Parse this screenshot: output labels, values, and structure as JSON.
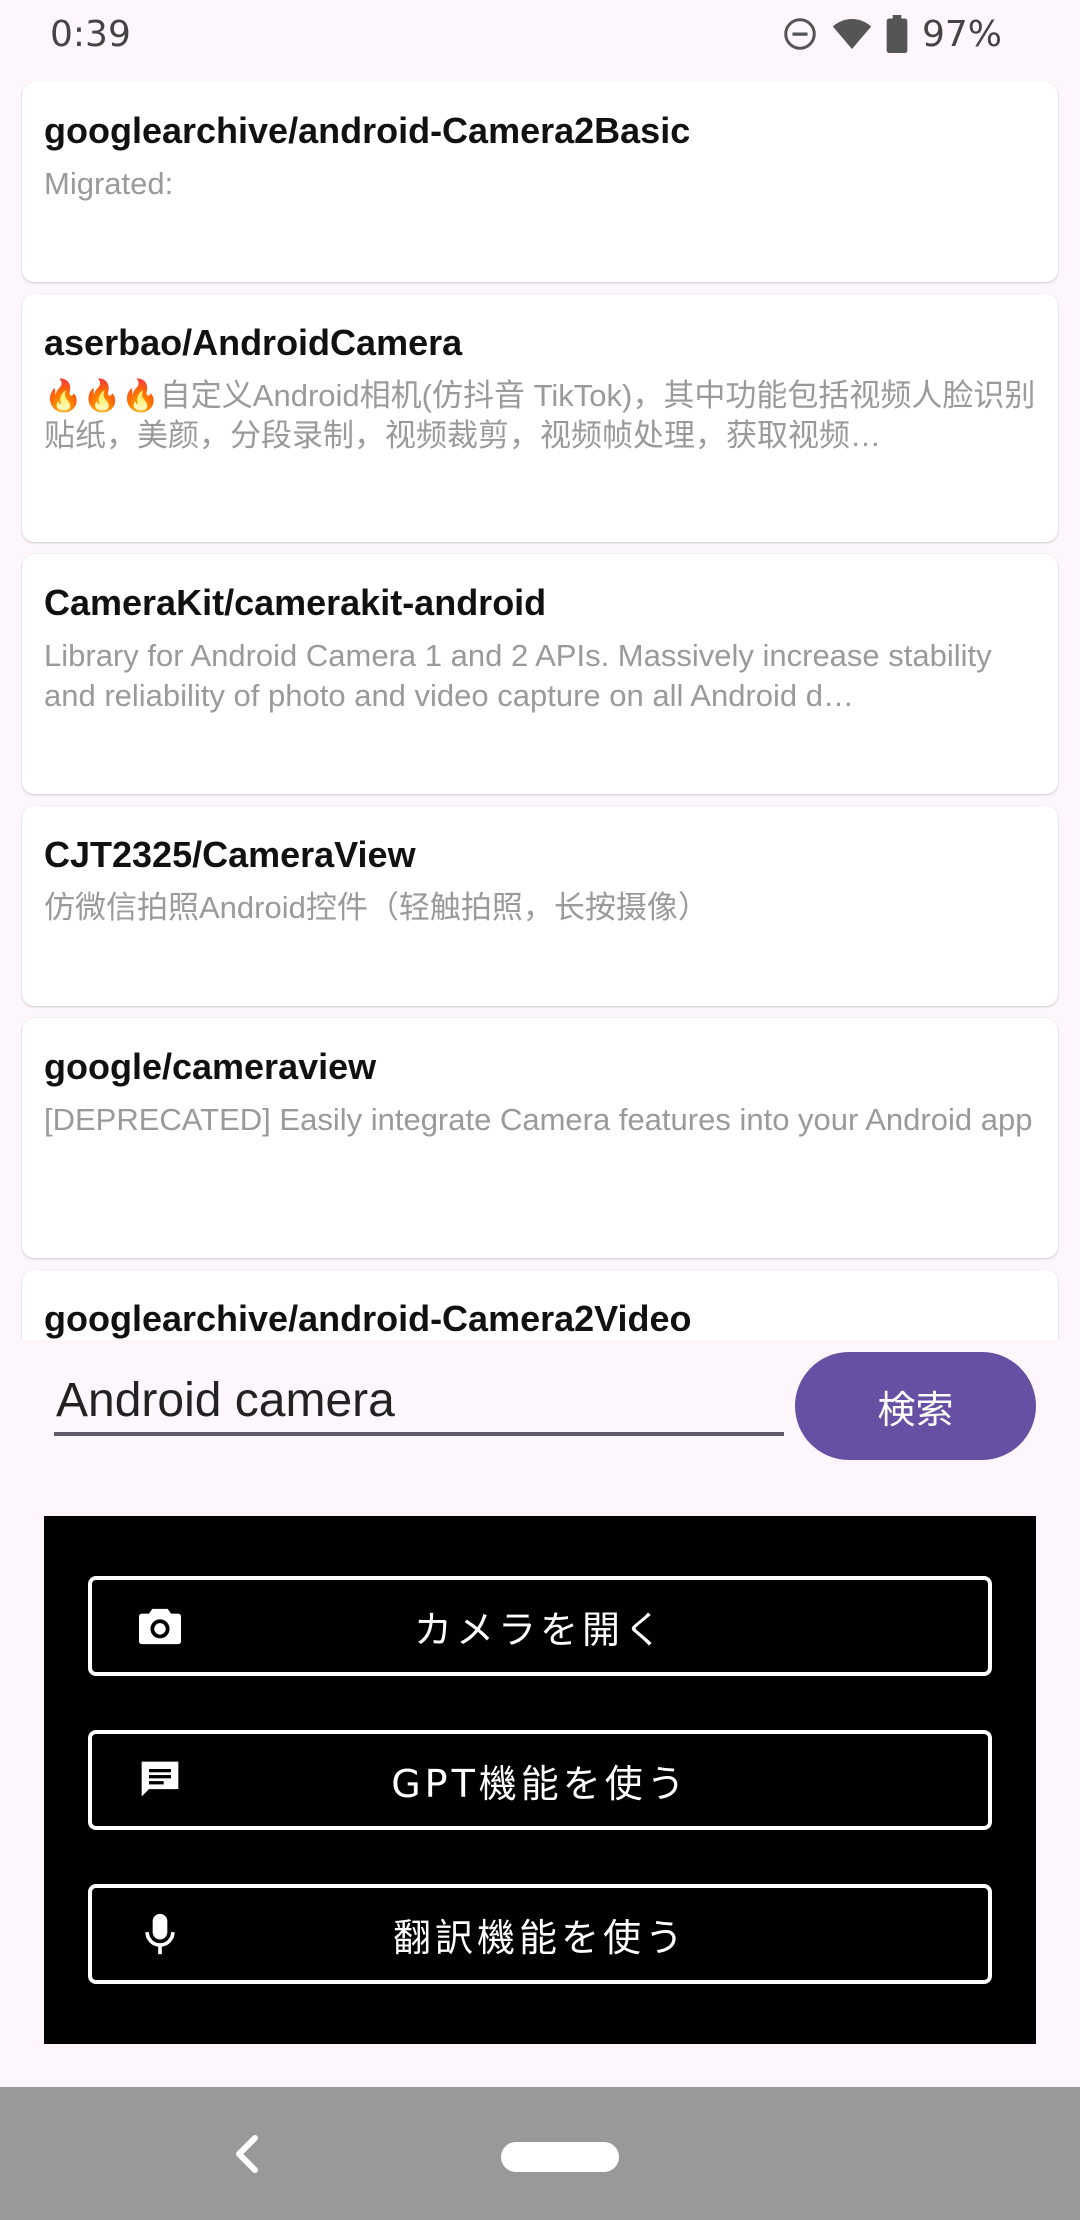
{
  "status_bar": {
    "time": "0:39",
    "battery": "97%",
    "icons": [
      "do-not-disturb-icon",
      "wifi-icon",
      "battery-icon"
    ]
  },
  "repos": [
    {
      "title": "googlearchive/android-Camera2Basic",
      "description": "Migrated:"
    },
    {
      "title": "aserbao/AndroidCamera",
      "description": "🔥🔥🔥自定义Android相机(仿抖音 TikTok)，其中功能包括视频人脸识别贴纸，美颜，分段录制，视频裁剪，视频帧处理，获取视频…"
    },
    {
      "title": "CameraKit/camerakit-android",
      "description": "Library for Android Camera 1 and 2 APIs. Massively increase stability and reliability of photo and video capture on all Android d…"
    },
    {
      "title": "CJT2325/CameraView",
      "description": "仿微信拍照Android控件（轻触拍照，长按摄像）"
    },
    {
      "title": "google/cameraview",
      "description": "[DEPRECATED] Easily integrate Camera features into your Android app"
    },
    {
      "title": "googlearchive/android-Camera2Video",
      "description": ""
    }
  ],
  "search": {
    "value": "Android camera",
    "button_label": "検索"
  },
  "actions": [
    {
      "label": "カメラを開く",
      "icon": "camera-icon"
    },
    {
      "label": "GPT機能を使う",
      "icon": "chat-icon"
    },
    {
      "label": "翻訳機能を使う",
      "icon": "microphone-icon"
    }
  ],
  "colors": {
    "background": "#fdf7fd",
    "accent": "#6750a4",
    "panel": "#000000",
    "nav_bar": "#999999"
  }
}
